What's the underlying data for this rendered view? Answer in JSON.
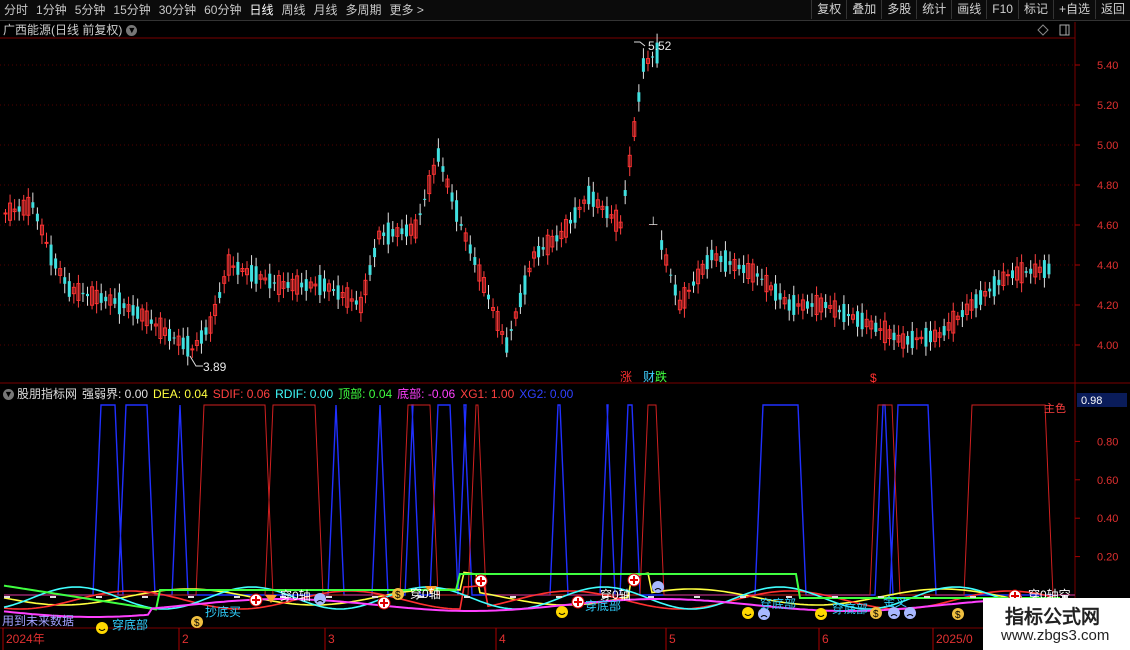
{
  "toolbar": {
    "periods": [
      "分时",
      "1分钟",
      "5分钟",
      "15分钟",
      "30分钟",
      "60分钟",
      "日线",
      "周线",
      "月线",
      "多周期",
      "更多 >"
    ],
    "active_period": "日线",
    "buttons": [
      "复权",
      "叠加",
      "多股",
      "统计",
      "画线",
      "F10",
      "标记",
      "+自选",
      "返回"
    ]
  },
  "main_chart": {
    "title": "广西能源(日线 前复权)",
    "price_ticks": [
      "5.40",
      "5.20",
      "5.00",
      "4.80",
      "4.60",
      "4.40",
      "4.20",
      "4.00"
    ],
    "high_label": "5.52",
    "low_label": "3.89",
    "markers": {
      "limit_up": "涨",
      "finance": "财",
      "limit_down": "跌",
      "dollar": "$"
    }
  },
  "indicator": {
    "name": "股朋指标网",
    "values": [
      {
        "label": "强弱界:",
        "value": "0.00",
        "color": "#e0e0e0"
      },
      {
        "label": "DEA:",
        "value": "0.04",
        "color": "#ffff40"
      },
      {
        "label": "SDIF:",
        "value": "0.06",
        "color": "#ff4040"
      },
      {
        "label": "RDIF:",
        "value": "0.00",
        "color": "#40ffff"
      },
      {
        "label": "顶部:",
        "value": "0.04",
        "color": "#40ff40"
      },
      {
        "label": "底部:",
        "value": "-0.06",
        "color": "#ff40ff"
      },
      {
        "label": "XG1:",
        "value": "1.00",
        "color": "#ff4040"
      },
      {
        "label": "XG2:",
        "value": "0.00",
        "color": "#3040ff"
      }
    ],
    "ticks": [
      "0.98",
      "0.80",
      "0.60",
      "0.40",
      "0.20"
    ],
    "current_label": "0.98",
    "right_red_label": "主色",
    "signal_labels": [
      "穿底部",
      "抄底买",
      "穿0轴",
      "穿0轴",
      "穿底部",
      "穿0轴",
      "穿底部",
      "穿底部",
      "金叉",
      "穿0轴空",
      "用到未来数据"
    ]
  },
  "x_axis": {
    "labels": [
      "2024年",
      "2",
      "3",
      "4",
      "5",
      "6",
      "2025/0"
    ]
  },
  "watermark": {
    "line1": "指标公式网",
    "line2": "www.zbgs3.com"
  }
}
